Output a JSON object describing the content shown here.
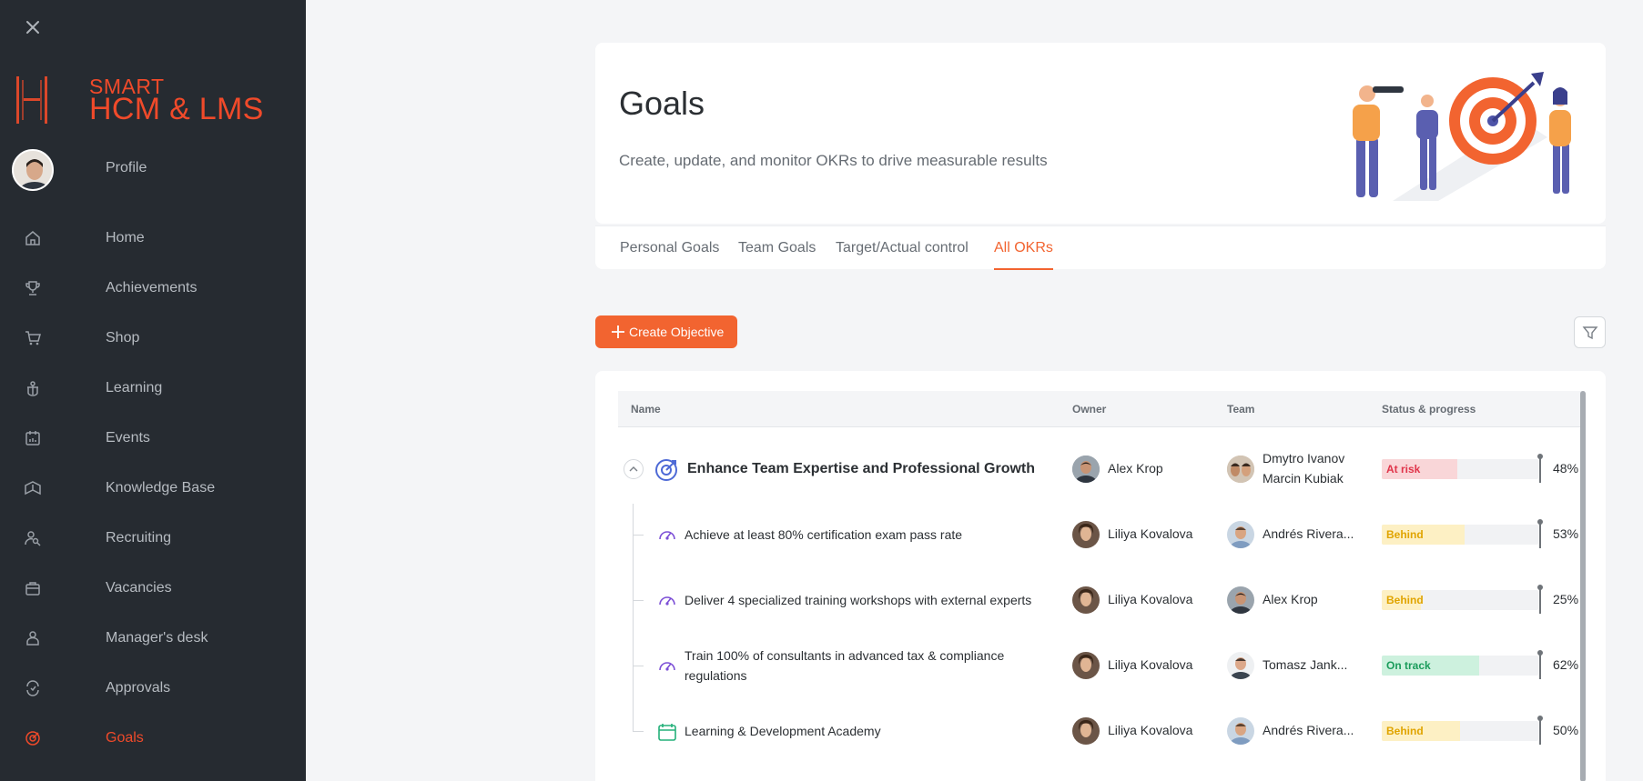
{
  "sidebar": {
    "close_icon": "close-icon",
    "logo": {
      "line1": "SMART",
      "line2": "HCM & LMS",
      "color": "#f04a2a"
    },
    "profile_label": "Profile",
    "items": [
      {
        "label": "Home",
        "icon": "home-icon"
      },
      {
        "label": "Achievements",
        "icon": "trophy-icon"
      },
      {
        "label": "Shop",
        "icon": "cart-icon"
      },
      {
        "label": "Learning",
        "icon": "graduation-icon"
      },
      {
        "label": "Events",
        "icon": "calendar-icon"
      },
      {
        "label": "Knowledge Base",
        "icon": "book-icon"
      },
      {
        "label": "Recruiting",
        "icon": "user-search-icon"
      },
      {
        "label": "Vacancies",
        "icon": "briefcase-icon"
      },
      {
        "label": "Manager's desk",
        "icon": "person-icon"
      },
      {
        "label": "Approvals",
        "icon": "refresh-check-icon"
      },
      {
        "label": "Goals",
        "icon": "target-icon",
        "active": true
      }
    ]
  },
  "header": {
    "title": "Goals",
    "subtitle": "Create, update, and monitor OKRs to drive measurable results"
  },
  "tabs": [
    {
      "label": "Personal Goals"
    },
    {
      "label": "Team Goals"
    },
    {
      "label": "Target/Actual control"
    },
    {
      "label": "All OKRs",
      "active": true
    }
  ],
  "actions": {
    "create_label": "Create Objective",
    "filter_icon": "filter-icon"
  },
  "table": {
    "columns": {
      "name": "Name",
      "owner": "Owner",
      "team": "Team",
      "status": "Status & progress"
    },
    "rows": [
      {
        "name": "Enhance Team Expertise and Professional Growth",
        "owner": "Alex Krop",
        "team": [
          "Dmytro Ivanov",
          "Marcin Kubiak"
        ],
        "status": "At risk",
        "progress": 48,
        "percent_label": "48%",
        "status_color": "#f9d6d8",
        "status_text_color": "#e0344a",
        "icon": "objective-target-icon"
      },
      {
        "name": "Achieve at least 80% certification exam pass rate",
        "owner": "Liliya Kovalova",
        "team": [
          "Andrés Rivera..."
        ],
        "status": "Behind",
        "progress": 53,
        "percent_label": "53%",
        "status_color": "#fdf0c4",
        "status_text_color": "#e0a400",
        "icon": "gauge-icon"
      },
      {
        "name": "Deliver 4 specialized training workshops with external experts",
        "owner": "Liliya Kovalova",
        "team": [
          "Alex Krop"
        ],
        "status": "Behind",
        "progress": 25,
        "percent_label": "25%",
        "status_color": "#fdf0c4",
        "status_text_color": "#e0a400",
        "icon": "gauge-icon"
      },
      {
        "name": "Train 100% of consultants in advanced tax & compliance",
        "name_line2": "regulations",
        "owner": "Liliya Kovalova",
        "team": [
          "Tomasz Jank..."
        ],
        "status": "On track",
        "progress": 62,
        "percent_label": "62%",
        "status_color": "#cdf1de",
        "status_text_color": "#1a9c5b",
        "icon": "gauge-icon"
      },
      {
        "name": "Learning & Development Academy",
        "owner": "Liliya Kovalova",
        "team": [
          "Andrés Rivera..."
        ],
        "status": "Behind",
        "progress": 50,
        "percent_label": "50%",
        "status_color": "#fdf0c4",
        "status_text_color": "#e0a400",
        "icon": "calendar-icon"
      }
    ]
  }
}
